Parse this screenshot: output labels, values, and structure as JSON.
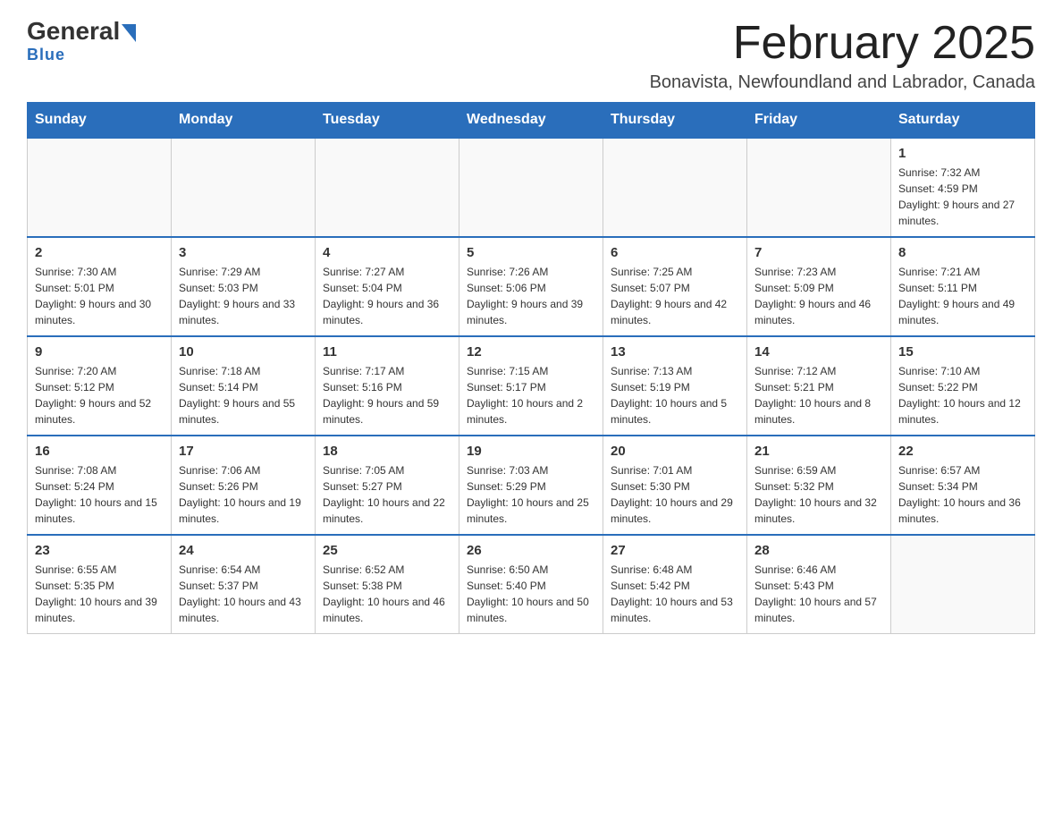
{
  "header": {
    "logo_main": "General",
    "logo_sub": "Blue",
    "title": "February 2025",
    "subtitle": "Bonavista, Newfoundland and Labrador, Canada"
  },
  "days_of_week": [
    "Sunday",
    "Monday",
    "Tuesday",
    "Wednesday",
    "Thursday",
    "Friday",
    "Saturday"
  ],
  "weeks": [
    [
      {
        "day": "",
        "info": ""
      },
      {
        "day": "",
        "info": ""
      },
      {
        "day": "",
        "info": ""
      },
      {
        "day": "",
        "info": ""
      },
      {
        "day": "",
        "info": ""
      },
      {
        "day": "",
        "info": ""
      },
      {
        "day": "1",
        "info": "Sunrise: 7:32 AM\nSunset: 4:59 PM\nDaylight: 9 hours and 27 minutes."
      }
    ],
    [
      {
        "day": "2",
        "info": "Sunrise: 7:30 AM\nSunset: 5:01 PM\nDaylight: 9 hours and 30 minutes."
      },
      {
        "day": "3",
        "info": "Sunrise: 7:29 AM\nSunset: 5:03 PM\nDaylight: 9 hours and 33 minutes."
      },
      {
        "day": "4",
        "info": "Sunrise: 7:27 AM\nSunset: 5:04 PM\nDaylight: 9 hours and 36 minutes."
      },
      {
        "day": "5",
        "info": "Sunrise: 7:26 AM\nSunset: 5:06 PM\nDaylight: 9 hours and 39 minutes."
      },
      {
        "day": "6",
        "info": "Sunrise: 7:25 AM\nSunset: 5:07 PM\nDaylight: 9 hours and 42 minutes."
      },
      {
        "day": "7",
        "info": "Sunrise: 7:23 AM\nSunset: 5:09 PM\nDaylight: 9 hours and 46 minutes."
      },
      {
        "day": "8",
        "info": "Sunrise: 7:21 AM\nSunset: 5:11 PM\nDaylight: 9 hours and 49 minutes."
      }
    ],
    [
      {
        "day": "9",
        "info": "Sunrise: 7:20 AM\nSunset: 5:12 PM\nDaylight: 9 hours and 52 minutes."
      },
      {
        "day": "10",
        "info": "Sunrise: 7:18 AM\nSunset: 5:14 PM\nDaylight: 9 hours and 55 minutes."
      },
      {
        "day": "11",
        "info": "Sunrise: 7:17 AM\nSunset: 5:16 PM\nDaylight: 9 hours and 59 minutes."
      },
      {
        "day": "12",
        "info": "Sunrise: 7:15 AM\nSunset: 5:17 PM\nDaylight: 10 hours and 2 minutes."
      },
      {
        "day": "13",
        "info": "Sunrise: 7:13 AM\nSunset: 5:19 PM\nDaylight: 10 hours and 5 minutes."
      },
      {
        "day": "14",
        "info": "Sunrise: 7:12 AM\nSunset: 5:21 PM\nDaylight: 10 hours and 8 minutes."
      },
      {
        "day": "15",
        "info": "Sunrise: 7:10 AM\nSunset: 5:22 PM\nDaylight: 10 hours and 12 minutes."
      }
    ],
    [
      {
        "day": "16",
        "info": "Sunrise: 7:08 AM\nSunset: 5:24 PM\nDaylight: 10 hours and 15 minutes."
      },
      {
        "day": "17",
        "info": "Sunrise: 7:06 AM\nSunset: 5:26 PM\nDaylight: 10 hours and 19 minutes."
      },
      {
        "day": "18",
        "info": "Sunrise: 7:05 AM\nSunset: 5:27 PM\nDaylight: 10 hours and 22 minutes."
      },
      {
        "day": "19",
        "info": "Sunrise: 7:03 AM\nSunset: 5:29 PM\nDaylight: 10 hours and 25 minutes."
      },
      {
        "day": "20",
        "info": "Sunrise: 7:01 AM\nSunset: 5:30 PM\nDaylight: 10 hours and 29 minutes."
      },
      {
        "day": "21",
        "info": "Sunrise: 6:59 AM\nSunset: 5:32 PM\nDaylight: 10 hours and 32 minutes."
      },
      {
        "day": "22",
        "info": "Sunrise: 6:57 AM\nSunset: 5:34 PM\nDaylight: 10 hours and 36 minutes."
      }
    ],
    [
      {
        "day": "23",
        "info": "Sunrise: 6:55 AM\nSunset: 5:35 PM\nDaylight: 10 hours and 39 minutes."
      },
      {
        "day": "24",
        "info": "Sunrise: 6:54 AM\nSunset: 5:37 PM\nDaylight: 10 hours and 43 minutes."
      },
      {
        "day": "25",
        "info": "Sunrise: 6:52 AM\nSunset: 5:38 PM\nDaylight: 10 hours and 46 minutes."
      },
      {
        "day": "26",
        "info": "Sunrise: 6:50 AM\nSunset: 5:40 PM\nDaylight: 10 hours and 50 minutes."
      },
      {
        "day": "27",
        "info": "Sunrise: 6:48 AM\nSunset: 5:42 PM\nDaylight: 10 hours and 53 minutes."
      },
      {
        "day": "28",
        "info": "Sunrise: 6:46 AM\nSunset: 5:43 PM\nDaylight: 10 hours and 57 minutes."
      },
      {
        "day": "",
        "info": ""
      }
    ]
  ]
}
